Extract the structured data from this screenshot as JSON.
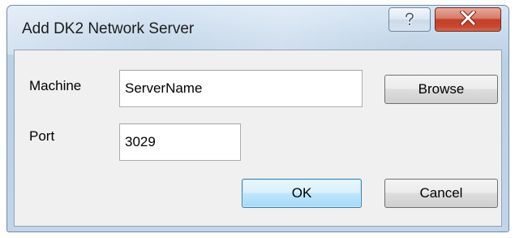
{
  "dialog": {
    "title": "Add DK2 Network Server",
    "help_icon": "question-mark-icon",
    "close_icon": "close-x-icon"
  },
  "form": {
    "machine_label": "Machine",
    "machine_value": "ServerName",
    "browse_label": "Browse",
    "port_label": "Port",
    "port_value": "3029",
    "ok_label": "OK",
    "cancel_label": "Cancel"
  },
  "colors": {
    "title_bar": "#c6d8ea",
    "client_background": "#f0f0f0",
    "close_button": "#c8462f",
    "default_button_border": "#3c7fb1"
  }
}
